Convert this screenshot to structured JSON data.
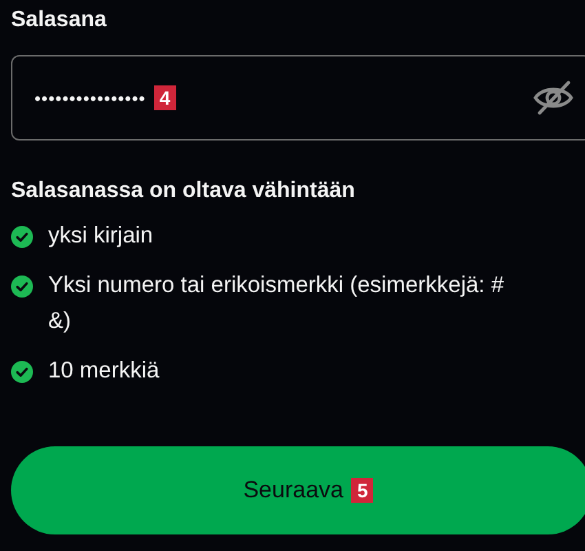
{
  "password_field": {
    "label": "Salasana",
    "value": "••••••••••••••••",
    "annotation": "4"
  },
  "requirements": {
    "heading": "Salasanassa on oltava vähintään",
    "items": [
      {
        "text": "yksi kirjain",
        "met": true
      },
      {
        "text": "Yksi numero tai erikoismerkki (esimerkkejä: #\n&)",
        "met": true
      },
      {
        "text": "10 merkkiä",
        "met": true
      }
    ]
  },
  "next_button": {
    "label": "Seuraava",
    "annotation": "5"
  }
}
